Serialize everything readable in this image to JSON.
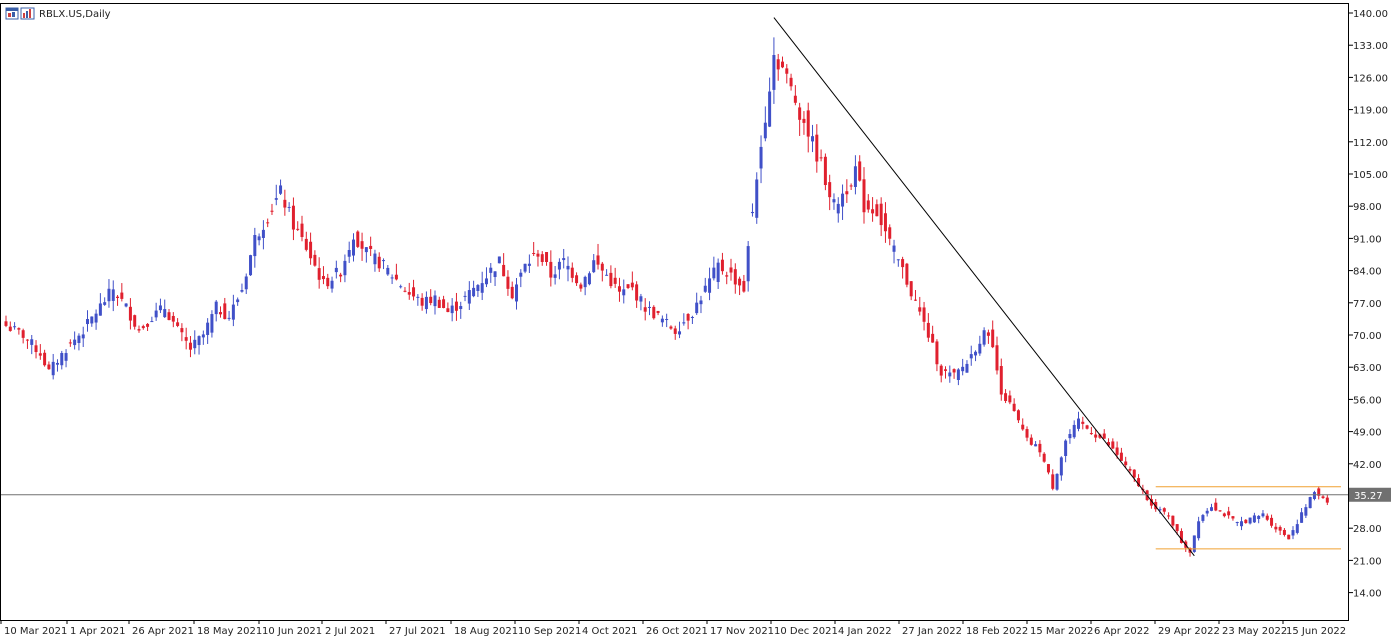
{
  "header": {
    "symbol_label": "RBLX.US,Daily"
  },
  "icons": [
    "chart-window-icon",
    "bar-chart-icon"
  ],
  "colors": {
    "bull": "#4050c8",
    "bear": "#e0202e",
    "level_lines": "#f0a030",
    "trend_line": "#000000",
    "current_price_line": "#707070",
    "price_tag_bg": "#707070",
    "frame": "#000000"
  },
  "chart_data": {
    "type": "candlestick",
    "title": "RBLX.US,Daily",
    "ylim": [
      11,
      142
    ],
    "y_ticks": [
      "140.00",
      "133.00",
      "126.00",
      "119.00",
      "112.00",
      "105.00",
      "98.00",
      "91.00",
      "84.00",
      "77.00",
      "70.00",
      "63.00",
      "56.00",
      "49.00",
      "42.00",
      "35.27",
      "28.00",
      "21.00",
      "14.00"
    ],
    "x_ticks": [
      "10 Mar 2021",
      "1 Apr 2021",
      "26 Apr 2021",
      "18 May 2021",
      "10 Jun 2021",
      "2 Jul 2021",
      "27 Jul 2021",
      "18 Aug 2021",
      "10 Sep 2021",
      "4 Oct 2021",
      "26 Oct 2021",
      "17 Nov 2021",
      "10 Dec 2021",
      "4 Jan 2022",
      "27 Jan 2022",
      "18 Feb 2022",
      "15 Mar 2022",
      "6 Apr 2022",
      "29 Apr 2022",
      "23 May 2022",
      "15 Jun 2022"
    ],
    "current_price": 35.27,
    "grid": false,
    "close_anchors": [
      [
        0,
        72
      ],
      [
        4,
        70
      ],
      [
        8,
        66
      ],
      [
        10,
        62
      ],
      [
        14,
        67
      ],
      [
        18,
        71
      ],
      [
        21,
        75
      ],
      [
        25,
        80
      ],
      [
        28,
        76
      ],
      [
        31,
        71
      ],
      [
        34,
        74
      ],
      [
        37,
        76
      ],
      [
        40,
        71
      ],
      [
        43,
        67
      ],
      [
        46,
        70
      ],
      [
        49,
        76
      ],
      [
        52,
        74
      ],
      [
        55,
        80
      ],
      [
        58,
        91
      ],
      [
        61,
        96
      ],
      [
        64,
        101
      ],
      [
        67,
        94
      ],
      [
        70,
        89
      ],
      [
        74,
        81
      ],
      [
        78,
        84
      ],
      [
        81,
        92
      ],
      [
        84,
        88
      ],
      [
        88,
        85
      ],
      [
        91,
        82
      ],
      [
        94,
        79
      ],
      [
        97,
        77
      ],
      [
        100,
        78
      ],
      [
        103,
        75
      ],
      [
        106,
        77
      ],
      [
        109,
        80
      ],
      [
        112,
        83
      ],
      [
        115,
        86
      ],
      [
        118,
        79
      ],
      [
        121,
        85
      ],
      [
        124,
        88
      ],
      [
        127,
        83
      ],
      [
        130,
        86
      ],
      [
        134,
        81
      ],
      [
        137,
        86
      ],
      [
        140,
        83
      ],
      [
        143,
        79
      ],
      [
        146,
        80
      ],
      [
        149,
        76
      ],
      [
        152,
        74
      ],
      [
        156,
        71
      ],
      [
        160,
        75
      ],
      [
        163,
        80
      ],
      [
        166,
        85
      ],
      [
        169,
        83
      ],
      [
        172,
        80
      ],
      [
        174,
        97
      ],
      [
        177,
        118
      ],
      [
        179,
        131
      ],
      [
        181,
        128
      ],
      [
        184,
        121
      ],
      [
        187,
        114
      ],
      [
        190,
        107
      ],
      [
        193,
        98
      ],
      [
        196,
        102
      ],
      [
        198,
        106
      ],
      [
        200,
        98
      ],
      [
        203,
        97
      ],
      [
        206,
        90
      ],
      [
        209,
        84
      ],
      [
        212,
        77
      ],
      [
        215,
        70
      ],
      [
        218,
        62
      ],
      [
        221,
        61
      ],
      [
        224,
        64
      ],
      [
        227,
        69
      ],
      [
        229,
        71
      ],
      [
        232,
        58
      ],
      [
        235,
        53
      ],
      [
        238,
        47
      ],
      [
        241,
        45
      ],
      [
        244,
        37
      ],
      [
        247,
        47
      ],
      [
        250,
        51
      ],
      [
        253,
        49
      ],
      [
        256,
        47
      ],
      [
        259,
        44
      ],
      [
        262,
        40
      ],
      [
        265,
        36
      ],
      [
        268,
        32
      ],
      [
        271,
        31
      ],
      [
        274,
        25
      ],
      [
        276,
        23
      ],
      [
        278,
        30
      ],
      [
        281,
        33
      ],
      [
        284,
        31
      ],
      [
        287,
        29
      ],
      [
        290,
        30
      ],
      [
        293,
        31
      ],
      [
        296,
        28
      ],
      [
        299,
        26
      ],
      [
        302,
        31
      ],
      [
        305,
        36
      ],
      [
        308,
        34
      ],
      [
        310,
        35.27
      ]
    ],
    "trend_line": [
      [
        179,
        139
      ],
      [
        277,
        22
      ]
    ],
    "resistance_level": 37,
    "support_level": 23.5,
    "level_start_index": 268
  }
}
